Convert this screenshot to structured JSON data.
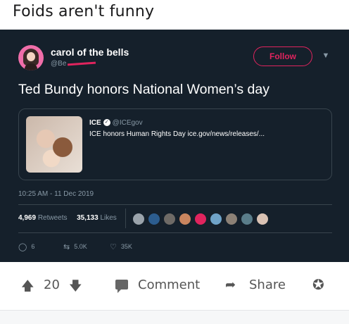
{
  "post": {
    "title": "Foids aren't funny"
  },
  "tweet": {
    "display_name": "carol of the bells",
    "handle": "@Be",
    "follow_label": "Follow",
    "more_icon": "chevron-down-icon",
    "text": "Ted Bundy honors National Women’s day",
    "quote": {
      "name": "ICE",
      "handle": "@ICEgov",
      "text": "ICE honors Human Rights Day ice.gov/news/releases/..."
    },
    "timestamp": "10:25 AM - 11 Dec 2019",
    "stats": {
      "retweets_count": "4,969",
      "retweets_label": "Retweets",
      "likes_count": "35,133",
      "likes_label": "Likes"
    },
    "actions": {
      "replies": "6",
      "retweets": "5.0K",
      "likes": "35K"
    },
    "accent_color": "#e0245e",
    "background_color": "#15202b"
  },
  "bottom_bar": {
    "vote_count": "20",
    "comment_label": "Comment",
    "share_label": "Share"
  }
}
